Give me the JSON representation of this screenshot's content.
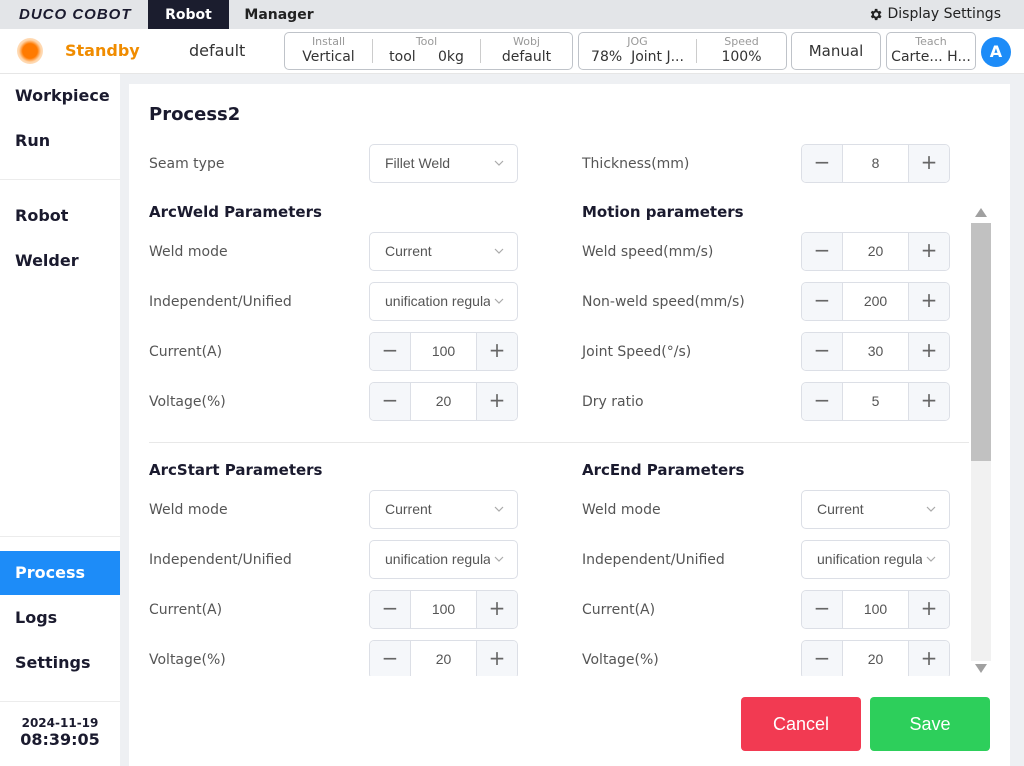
{
  "app": {
    "logo": "DUCO COBOT"
  },
  "top_tabs": {
    "robot": "Robot",
    "manager": "Manager"
  },
  "display_settings": "Display Settings",
  "status": {
    "state": "Standby",
    "profile": "default"
  },
  "info": {
    "install_label": "Install",
    "install_value": "Vertical",
    "tool_label": "Tool",
    "tool_value": "tool",
    "tool_weight": "0kg",
    "wobj_label": "Wobj",
    "wobj_value": "default",
    "jog_label": "JOG",
    "jog_value": "78%",
    "jog_mode": "Joint J...",
    "speed_label": "Speed",
    "speed_value": "100%",
    "manual_label": "Manual",
    "teach_label": "Teach",
    "teach_value": "Carte... H..."
  },
  "user": {
    "initial": "A"
  },
  "sidebar": {
    "workpiece": "Workpiece",
    "run": "Run",
    "robot": "Robot",
    "welder": "Welder",
    "process": "Process",
    "logs": "Logs",
    "settings": "Settings",
    "date": "2024-11-19",
    "time": "08:39:05"
  },
  "panel": {
    "title": "Process2",
    "seam_type": {
      "label": "Seam type",
      "value": "Fillet Weld"
    },
    "thickness": {
      "label": "Thickness(mm)",
      "value": "8"
    },
    "arcweld": {
      "title": "ArcWeld Parameters",
      "weld_mode": {
        "label": "Weld mode",
        "value": "Current"
      },
      "indep": {
        "label": "Independent/Unified",
        "value": "unification regula"
      },
      "current": {
        "label": "Current(A)",
        "value": "100"
      },
      "voltage": {
        "label": "Voltage(%)",
        "value": "20"
      }
    },
    "motion": {
      "title": "Motion parameters",
      "weld_speed": {
        "label": "Weld speed(mm/s)",
        "value": "20"
      },
      "nonweld_speed": {
        "label": "Non-weld speed(mm/s)",
        "value": "200"
      },
      "joint_speed": {
        "label": "Joint Speed(°/s)",
        "value": "30"
      },
      "dry_ratio": {
        "label": "Dry ratio",
        "value": "5"
      }
    },
    "arcstart": {
      "title": "ArcStart Parameters",
      "weld_mode": {
        "label": "Weld mode",
        "value": "Current"
      },
      "indep": {
        "label": "Independent/Unified",
        "value": "unification regula"
      },
      "current": {
        "label": "Current(A)",
        "value": "100"
      },
      "voltage": {
        "label": "Voltage(%)",
        "value": "20"
      }
    },
    "arcend": {
      "title": "ArcEnd Parameters",
      "weld_mode": {
        "label": "Weld mode",
        "value": "Current"
      },
      "indep": {
        "label": "Independent/Unified",
        "value": "unification regula"
      },
      "current": {
        "label": "Current(A)",
        "value": "100"
      },
      "voltage": {
        "label": "Voltage(%)",
        "value": "20"
      }
    },
    "stepper_minus": "−",
    "stepper_plus": "+",
    "cancel_label": "Cancel",
    "save_label": "Save"
  },
  "colors": {
    "accent": "#1d8cf8",
    "standby": "#f08c00",
    "cancel": "#f23a52",
    "save": "#2dcf5b",
    "dark": "#1b1d2e"
  }
}
